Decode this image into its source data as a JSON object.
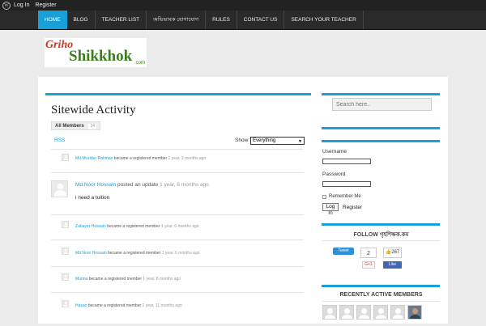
{
  "adminbar": {
    "wp_glyph": "W",
    "login": "Log In",
    "register": "Register"
  },
  "nav": [
    "HOME",
    "BLOG",
    "TEACHER LIST",
    "অভিভাবক যোগাযোগ",
    "RULES",
    "CONTACT US",
    "SEARCH YOUR TEACHER"
  ],
  "logo": {
    "part1": "Griho",
    "part2": "Shikkhok",
    "part3": ".com"
  },
  "page": {
    "title": "Sitewide Activity",
    "tab_label": "All Members",
    "tab_count": "34",
    "rss": "RSS",
    "show_label": "Show:",
    "show_value": "Everything",
    "select_arrow": "▼"
  },
  "activity": [
    {
      "name": "Md.Mozidur Rahman",
      "text": "became a registered member",
      "time": "1 year, 2 months ago"
    },
    {
      "name": "Md.Noor Hossain",
      "text": "posted an update",
      "time": "1 year, 6 months ago",
      "body": "i need a tuition"
    },
    {
      "name": "Zubayer Hossain",
      "text": "became a registered member",
      "time": "1 year, 6 months ago"
    },
    {
      "name": "Md.Noor Hossain",
      "text": "became a registered member",
      "time": "1 year, 6 months ago"
    },
    {
      "name": "Munna",
      "text": "became a registered member",
      "time": "1 year, 8 months ago"
    },
    {
      "name": "Hasan",
      "text": "became a registered member",
      "time": "1 year, 11 months ago"
    }
  ],
  "sidebar": {
    "search_placeholder": "Search here..",
    "username_label": "Username",
    "password_label": "Password",
    "remember_label": "Remember Me",
    "login_button": "Log In",
    "register_link": "Register",
    "follow_title": "FOLLOW গৃহশিক্ষক.কম",
    "tweet_label": "Tweet",
    "tweet_count": "2",
    "gplus_label": "G+1",
    "like_count": "267",
    "like_label": "Like",
    "recent_title": "RECENTLY ACTIVE MEMBERS"
  },
  "colors": {
    "accent": "#1aa0d8",
    "nav_bg": "#2a2a2a",
    "adminbar_bg": "#222222",
    "link": "#1aa0d8",
    "twitter": "#2b90d9",
    "facebook": "#4267b2"
  }
}
